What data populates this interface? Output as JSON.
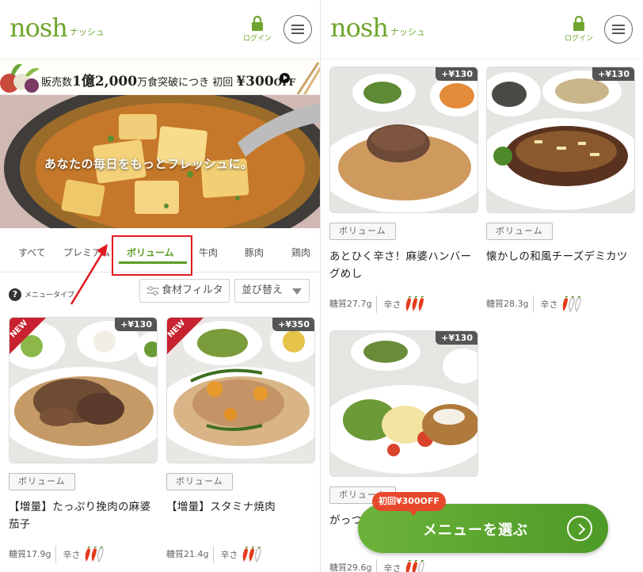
{
  "brand": {
    "logo": "nosh",
    "logo_sub": "ナッシュ",
    "accent": "#5e9c26",
    "alert": "#e3191f"
  },
  "header": {
    "login_label": "ログイン"
  },
  "banner": {
    "prefix": "販売数",
    "count": "1億2,000",
    "suffix": "万食突破につき 初回 ",
    "discount": "¥300",
    "off": "OFF"
  },
  "hero": {
    "tagline": "あなたの毎日をもっとフレッシュに。"
  },
  "tabs": [
    {
      "label": "すべて"
    },
    {
      "label": "プレミアム"
    },
    {
      "label": "ボリューム"
    },
    {
      "label": "牛肉"
    },
    {
      "label": "豚肉"
    },
    {
      "label": "鶏肉"
    }
  ],
  "active_tab": "ボリューム",
  "filter": {
    "menu_type_label": "メニュータイプ",
    "ingredient_filter": "食材フィルタ",
    "sort": "並び替え"
  },
  "left_cards": [
    {
      "price": "+¥130",
      "badge": "NEW",
      "category": "ボリューム",
      "name": "【増量】たっぷり挽肉の麻婆茄子",
      "sugar": "糖質17.9g",
      "spice_label": "辛さ",
      "spice_level": 2
    },
    {
      "price": "+¥350",
      "badge": "NEW",
      "category": "ボリューム",
      "name": "【増量】スタミナ焼肉",
      "sugar": "糖質21.4g",
      "spice_label": "辛さ",
      "spice_level": 2
    }
  ],
  "right_cards": [
    {
      "price": "+¥130",
      "category": "ボリューム",
      "name": "あとひく辛さ！麻婆ハンバーグめし",
      "sugar": "糖質27.7g",
      "spice_label": "辛さ",
      "spice_level": 3
    },
    {
      "price": "+¥130",
      "category": "ボリューム",
      "name": "懐かしの和風チーズデミカツ",
      "sugar": "糖質28.3g",
      "spice_label": "辛さ",
      "spice_level": 1
    },
    {
      "price": "+¥130",
      "category": "ボリューム",
      "name": "がっつりライス",
      "sugar": "糖質29.6g",
      "spice_label": "辛さ",
      "spice_level": 2
    }
  ],
  "cta": {
    "label": "メニューを選ぶ",
    "badge": "初回¥300OFF"
  }
}
